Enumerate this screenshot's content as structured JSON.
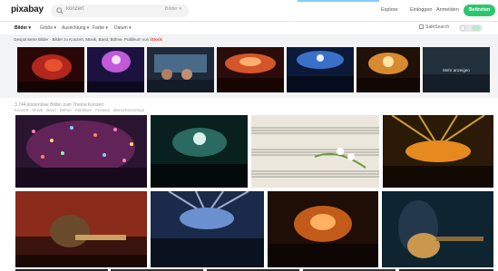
{
  "header": {
    "logo": "pixabay",
    "search": {
      "placeholder": "konzert",
      "type_label": "Bilder"
    },
    "nav": {
      "explore": "Explore",
      "login": "Einloggen",
      "join_text": "Anmelden",
      "join_button": "Beitreten"
    }
  },
  "filters": {
    "items": [
      "Bilder",
      "Größe",
      "Ausrichtung",
      "Farbe",
      "Datum"
    ],
    "safe_search": "SafeSearch",
    "active_index": 0
  },
  "sponsored": {
    "label": "Gesponserte Bilder · Bilder zu Konzert, Musik, Band, Bühne, Publikum von",
    "brand": "iStock",
    "more_label": "Mehr anzeigen"
  },
  "related": {
    "title": "3.744 kostenlose Bilder zum Thema Konzert",
    "tags": "Konzert · Musik · Band · Bühne · Publikum · Festival · Menschenmenge"
  },
  "icons": {
    "search": "search-icon",
    "chevron": "chevron-down-icon"
  },
  "colors": {
    "accent": "#2ec66d",
    "brand_istock": "#e33333"
  }
}
